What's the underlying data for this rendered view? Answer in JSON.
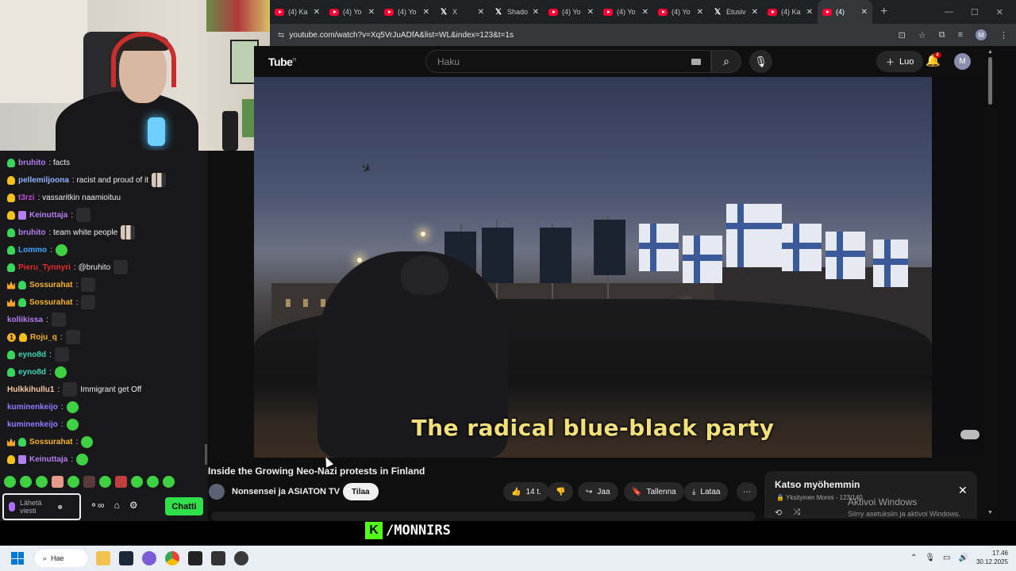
{
  "browser": {
    "tabs": [
      {
        "label": "(4) Ka",
        "icon": "youtube-icon"
      },
      {
        "label": "(4) Yo",
        "icon": "youtube-icon"
      },
      {
        "label": "(4) Yo",
        "icon": "youtube-icon"
      },
      {
        "label": "X",
        "icon": "x-icon"
      },
      {
        "label": "Shado",
        "icon": "x-icon"
      },
      {
        "label": "(4) Yo",
        "icon": "youtube-icon"
      },
      {
        "label": "(4) Yo",
        "icon": "youtube-icon"
      },
      {
        "label": "(4) Yo",
        "icon": "youtube-icon"
      },
      {
        "label": "Etusiv",
        "icon": "x-icon"
      },
      {
        "label": "(4) Ka",
        "icon": "youtube-icon"
      },
      {
        "label": "(4)",
        "icon": "youtube-icon",
        "active": true
      }
    ],
    "url": "youtube.com/watch?v=Xq5VrJuADfA&list=WL&index=123&t=1s",
    "profile_initial": "M"
  },
  "youtube": {
    "logo_text": "Tube",
    "logo_region": "FI",
    "search_placeholder": "Haku",
    "create_label": "Luo",
    "notification_count": "4",
    "avatar_initial": "M",
    "video": {
      "subtitle": "The radical blue-black party",
      "title": "Inside the Growing Neo-Nazi protests in Finland",
      "channel": "Nonsensei ja ASIATON TV",
      "subscribe_label": "Tilaa",
      "likes": "14 t.",
      "share_label": "Jaa",
      "save_label": "Tallenna",
      "download_label": "Lataa"
    },
    "watch_later": {
      "title": "Katso myöhemmin",
      "privacy": "Yksityinen",
      "owner": "Monni",
      "position": "123/140"
    }
  },
  "windows_watermark": {
    "title": "Aktivoi Windows",
    "subtitle": "Siirry asetuksiin ja aktivoi Windows."
  },
  "chat": {
    "messages": [
      {
        "user": "bruhito",
        "color": "#b37ef0",
        "badges": [
          "green"
        ],
        "text": ": facts",
        "emotes": []
      },
      {
        "user": "pellemiljoona",
        "color": "#8fb3ff",
        "badges": [
          "gold"
        ],
        "text": ": racist and proud of it",
        "emotes": [
          "ppl"
        ]
      },
      {
        "user": "t3rzi",
        "color": "#c04ed8",
        "badges": [
          "gold"
        ],
        "text": ": vassaritkin naamioituu",
        "emotes": []
      },
      {
        "user": "Keinuttaja",
        "color": "#b37ef0",
        "badges": [
          "gold",
          "sub"
        ],
        "text": ":",
        "emotes": [
          "dark"
        ]
      },
      {
        "user": "bruhito",
        "color": "#b37ef0",
        "badges": [
          "green"
        ],
        "text": ": team white people",
        "emotes": [
          "ppl"
        ]
      },
      {
        "user": "Lommo",
        "color": "#3aa7ff",
        "badges": [
          "green"
        ],
        "text": ":",
        "emotes": [
          "pepe"
        ]
      },
      {
        "user": "Pieru_Tynnyri",
        "color": "#e52b2b",
        "badges": [
          "green"
        ],
        "text": ": @bruhito",
        "emotes": [
          "dark"
        ]
      },
      {
        "user": "Sossurahat",
        "color": "#f5b324",
        "badges": [
          "crown",
          "green"
        ],
        "text": ":",
        "emotes": [
          "dark"
        ]
      },
      {
        "user": "Sossurahat",
        "color": "#f5b324",
        "badges": [
          "crown",
          "green"
        ],
        "text": ":",
        "emotes": [
          "dark"
        ]
      },
      {
        "user": "kollikissa",
        "color": "#b37ef0",
        "badges": [],
        "text": ":",
        "emotes": [
          "dark"
        ]
      },
      {
        "user": "Roju_q",
        "color": "#f5b324",
        "badges": [
          "num1",
          "gold"
        ],
        "text": ":",
        "emotes": [
          "dark"
        ]
      },
      {
        "user": "eyno8d",
        "color": "#3ad6b8",
        "badges": [
          "green"
        ],
        "text": ":",
        "emotes": [
          "dark"
        ]
      },
      {
        "user": "eyno8d",
        "color": "#3ad6b8",
        "badges": [
          "green"
        ],
        "text": ":",
        "emotes": [
          "pepe"
        ]
      },
      {
        "user": "Hulkkihullu1",
        "color": "#f5c8a0",
        "badges": [],
        "text": ":",
        "emotes": [
          "dark"
        ],
        "after": "Immigrant get Off"
      },
      {
        "user": "kuminenkeijo",
        "color": "#8f7dff",
        "badges": [],
        "text": ":",
        "emotes": [
          "pepe"
        ]
      },
      {
        "user": "kuminenkeijo",
        "color": "#8f7dff",
        "badges": [],
        "text": ":",
        "emotes": [
          "pepe"
        ]
      },
      {
        "user": "Sossurahat",
        "color": "#f5b324",
        "badges": [
          "crown",
          "green"
        ],
        "text": ":",
        "emotes": [
          "pepe"
        ]
      },
      {
        "user": "Keinuttaja",
        "color": "#b37ef0",
        "badges": [
          "gold",
          "sub"
        ],
        "text": ":",
        "emotes": [
          "pepe"
        ]
      }
    ],
    "input_placeholder": "Lähetä viesti",
    "send_label": "Chatti"
  },
  "overlay": {
    "brand": "/MONNIRS",
    "brand_letter": "K"
  },
  "taskbar": {
    "search_label": "Hae",
    "time": "17.46",
    "date": "30.12.2025"
  }
}
